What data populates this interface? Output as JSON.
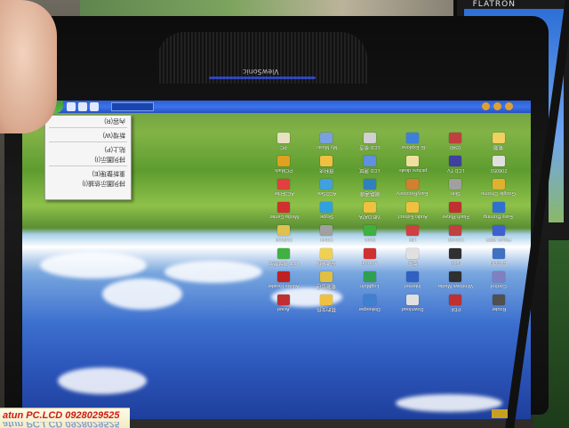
{
  "caption": {
    "text": "atun PC.LCD  0928029525"
  },
  "monitor": {
    "brand": "ViewSonic"
  },
  "background_monitor": {
    "brand": "FLATRON"
  },
  "context_menu": {
    "items": [
      "內容(R)",
      "",
      "新增(W)",
      "",
      "貼上(P)",
      "排列圖示(I)",
      "",
      "重新整理(E)",
      "排列圖示依據(I)"
    ]
  },
  "desktop_icons": [
    {
      "label": "PC",
      "color": "#e8e0c0"
    },
    {
      "label": "My Music",
      "color": "#7aa0e0"
    },
    {
      "label": "LCD 檢查",
      "color": "#d0d0d0"
    },
    {
      "label": "IE Explorer",
      "color": "#3f7fdc"
    },
    {
      "label": "0340",
      "color": "#c04040"
    },
    {
      "label": "電腦",
      "color": "#f0d060"
    },
    {
      "label": "PCMark",
      "color": "#e0a020"
    },
    {
      "label": "資料夾",
      "color": "#f0c040"
    },
    {
      "label": "LCD 測試",
      "color": "#6090e0"
    },
    {
      "label": "picture deals",
      "color": "#f0e0a0"
    },
    {
      "label": "LCD TV",
      "color": "#4040a0"
    },
    {
      "label": "208059",
      "color": "#e0e0e0"
    },
    {
      "label": "AC3Filter",
      "color": "#e04040"
    },
    {
      "label": "ACDSee",
      "color": "#40a0e0"
    },
    {
      "label": "網路連線",
      "color": "#3080c0"
    },
    {
      "label": "EasyRecovery",
      "color": "#d08030"
    },
    {
      "label": "Skin",
      "color": "#a0a0a0"
    },
    {
      "label": "Google Chrome",
      "color": "#e0b030"
    },
    {
      "label": "Media Center",
      "color": "#d03030"
    },
    {
      "label": "Skype",
      "color": "#30a0e0"
    },
    {
      "label": "NB DATA",
      "color": "#f0c040"
    },
    {
      "label": "Audio Extract",
      "color": "#f0c040"
    },
    {
      "label": "Flash Player",
      "color": "#c03030"
    },
    {
      "label": "Easy Burning",
      "color": "#3070d0"
    },
    {
      "label": "Outlook",
      "color": "#e0c050"
    },
    {
      "label": "Driver",
      "color": "#a0a0a0"
    },
    {
      "label": "Scan",
      "color": "#40b040"
    },
    {
      "label": "Lite",
      "color": "#d04040"
    },
    {
      "label": "Convert",
      "color": "#c04040"
    },
    {
      "label": "Player 2004",
      "color": "#4060d0"
    },
    {
      "label": "LCD 測試程式",
      "color": "#40b040"
    },
    {
      "label": "光碟燒錄",
      "color": "#f0d050"
    },
    {
      "label": "Acrobat",
      "color": "#d03030"
    },
    {
      "label": "檔案",
      "color": "#e0e0e0"
    },
    {
      "label": "Nero",
      "color": "#303030"
    },
    {
      "label": "EPSON",
      "color": "#4070c0"
    },
    {
      "label": "Adobe Reader",
      "color": "#c02020"
    },
    {
      "label": "電腦管理",
      "color": "#e0c040"
    },
    {
      "label": "LogMeIn",
      "color": "#30a050"
    },
    {
      "label": "Internet",
      "color": "#3060c0"
    },
    {
      "label": "Windows Media",
      "color": "#303030"
    },
    {
      "label": "Control",
      "color": "#8080c0"
    },
    {
      "label": "Avast",
      "color": "#c03030"
    },
    {
      "label": "我的文件",
      "color": "#f0c040"
    },
    {
      "label": "Diskeeper",
      "color": "#4080d0"
    },
    {
      "label": "Download",
      "color": "#e0e0e0"
    },
    {
      "label": "PDF",
      "color": "#c03030"
    },
    {
      "label": "Router",
      "color": "#505050"
    }
  ]
}
